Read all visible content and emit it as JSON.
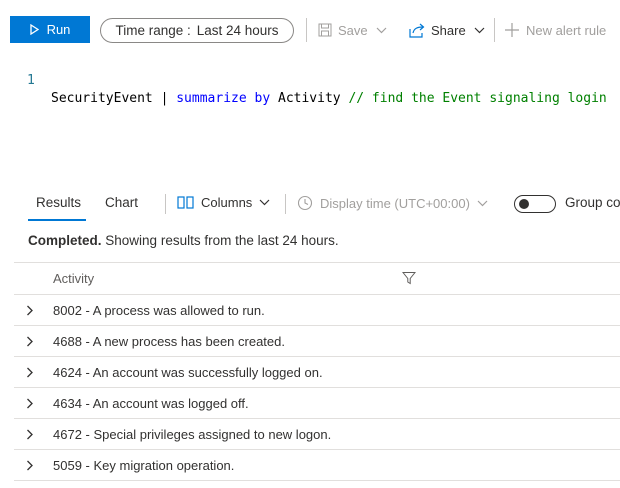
{
  "toolbar": {
    "run_label": "Run",
    "time_range_label": "Time range :",
    "time_range_value": "Last 24 hours",
    "save_label": "Save",
    "share_label": "Share",
    "new_alert_label": "New alert rule"
  },
  "editor": {
    "line_number": "1",
    "tokens": {
      "table": "SecurityEvent | ",
      "kw_summarize": "summarize",
      "kw_by": "by",
      "column": "Activity ",
      "comment": "// find the Event signaling login"
    }
  },
  "results": {
    "tabs": [
      {
        "label": "Results",
        "active": true
      },
      {
        "label": "Chart",
        "active": false
      }
    ],
    "columns_label": "Columns",
    "display_time_label": "Display time (UTC+00:00)",
    "group_toggle_label": "Group col",
    "status_bold": "Completed.",
    "status_text": "Showing results from the last 24 hours.",
    "column_header": "Activity",
    "rows": [
      "8002 - A process was allowed to run.",
      "4688 - A new process has been created.",
      "4624 - An account was successfully logged on.",
      "4634 - An account was logged off.",
      "4672 - Special privileges assigned to new logon.",
      "5059 - Key migration operation."
    ]
  },
  "colors": {
    "accent": "#0078d4",
    "keyword": "#0000ff",
    "comment": "#008000",
    "disabled": "#a19f9d"
  },
  "icons": [
    "play-icon",
    "chevron-down-icon",
    "save-icon",
    "share-icon",
    "plus-icon",
    "columns-icon",
    "clock-icon",
    "filter-icon",
    "chevron-right-icon"
  ]
}
